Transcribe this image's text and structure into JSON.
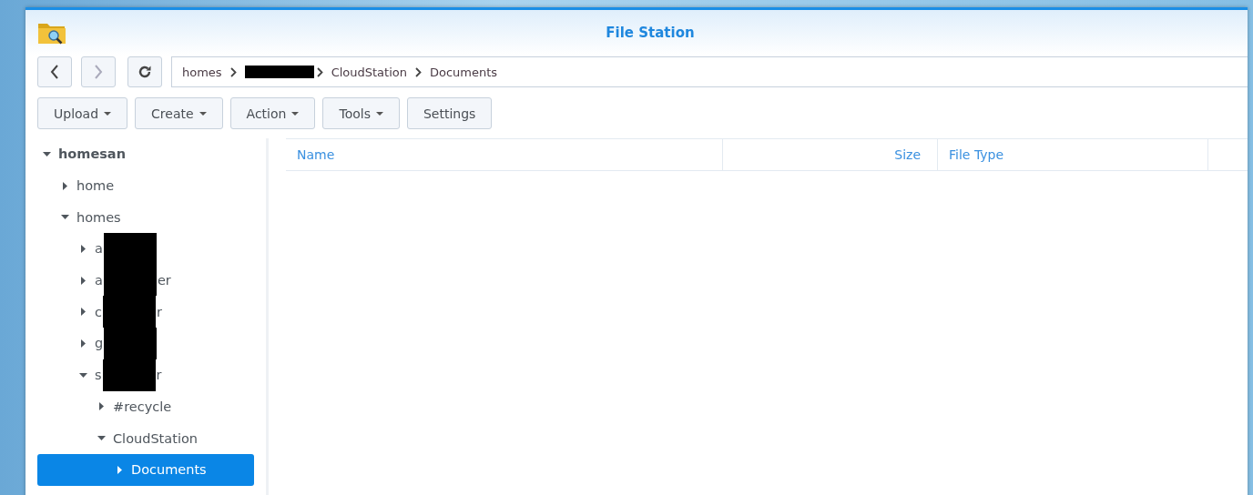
{
  "window": {
    "title": "File Station"
  },
  "nav_buttons": [
    {
      "kind": "back",
      "disabled": false
    },
    {
      "kind": "forward",
      "disabled": true
    },
    {
      "kind": "refresh",
      "disabled": false
    }
  ],
  "breadcrumb": [
    {
      "kind": "text",
      "label": "homes"
    },
    {
      "kind": "redacted"
    },
    {
      "kind": "text",
      "label": "CloudStation"
    },
    {
      "kind": "text",
      "label": "Documents"
    }
  ],
  "toolbar": [
    {
      "label": "Upload",
      "dropdown": true
    },
    {
      "label": "Create",
      "dropdown": true
    },
    {
      "label": "Action",
      "dropdown": true
    },
    {
      "label": "Tools",
      "dropdown": true
    },
    {
      "label": "Settings",
      "dropdown": false
    }
  ],
  "tree": [
    {
      "label": "homesan",
      "expanded": true,
      "selected": false,
      "children": [
        {
          "label": "home",
          "expanded": false,
          "selected": false
        },
        {
          "label": "homes",
          "expanded": true,
          "selected": false,
          "children": [
            {
              "label": "a",
              "redacted": true,
              "expanded": false,
              "selected": false
            },
            {
              "label": "a",
              "label_end": "er",
              "redacted": true,
              "expanded": false,
              "selected": false
            },
            {
              "label": "c",
              "label_end": "r",
              "redacted": true,
              "expanded": false,
              "selected": false
            },
            {
              "label": "g",
              "redacted": true,
              "expanded": false,
              "selected": false
            },
            {
              "label": "s",
              "label_end": "r",
              "redacted": true,
              "expanded": true,
              "selected": false,
              "children": [
                {
                  "label": "#recycle",
                  "expanded": false,
                  "selected": false
                },
                {
                  "label": "CloudStation",
                  "expanded": true,
                  "selected": false,
                  "children": [
                    {
                      "label": "Documents",
                      "expanded": false,
                      "selected": true
                    }
                  ]
                }
              ]
            }
          ]
        }
      ]
    }
  ],
  "table": {
    "columns": [
      {
        "label": "Name",
        "kind": "text"
      },
      {
        "label": "Size",
        "kind": "numeric"
      },
      {
        "label": "File Type",
        "kind": "text"
      }
    ]
  }
}
